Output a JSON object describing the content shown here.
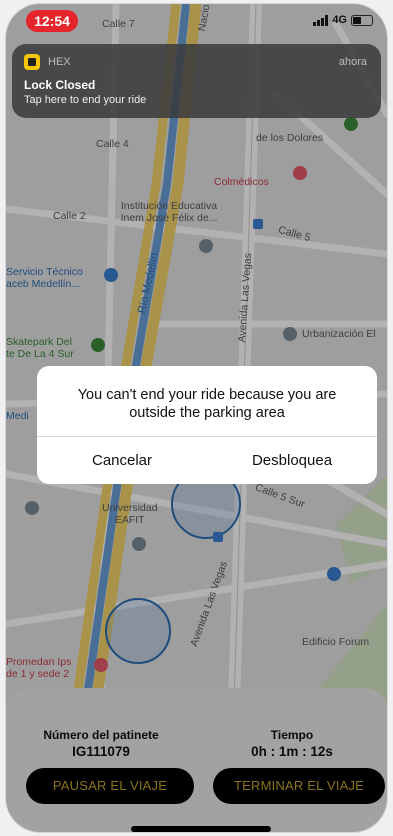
{
  "status_bar": {
    "time": "12:54",
    "network": "4G"
  },
  "notification": {
    "app_name": "HEX",
    "time": "ahora",
    "title": "Lock Closed",
    "body": "Tap here to end your ride"
  },
  "map": {
    "labels": {
      "calle7": "Calle 7",
      "calle4": "Calle 4",
      "calle2": "Calle 2",
      "calle5": "Calle 5",
      "calle5sur": "Calle 5 Sur",
      "nacional": "Nacional",
      "dolores": "de los Dolores",
      "colmedicos": "Colmédicos",
      "inem": "Institución Educativa\nInem José Félix de...",
      "servicio": "Servicio Técnico\naceb Medellín...",
      "rio": "Río Medellín",
      "avenida_top": "Avenida Las Vegas",
      "avenida_bottom": "Avenida Las Vegas",
      "skatepark": "Skatepark Del\nte De La 4 Sur",
      "urbanizacion": "Urbanización El",
      "medi": "Medi",
      "universidad": "Universidad\nEAFIT",
      "forum": "Edificio Forum",
      "promedan": "Promedan Ips\nde 1 y sede 2"
    }
  },
  "dialog": {
    "message": "You can't end your ride because you are outside the parking area",
    "cancel_label": "Cancelar",
    "confirm_label": "Desbloquea"
  },
  "trip": {
    "scooter_label": "Número del patinete",
    "scooter_id": "IG111079",
    "time_label": "Tiempo",
    "time_value": "0h : 1m : 12s",
    "pause_label": "PAUSAR EL VIAJE",
    "end_label": "TERMINAR EL VIAJE"
  },
  "colors": {
    "accent": "#c8a52a",
    "notification_bg": "#3a3a3c",
    "time_pill": "#e4252b",
    "river": "#6a9fd8",
    "highway": "#f2d36b"
  }
}
